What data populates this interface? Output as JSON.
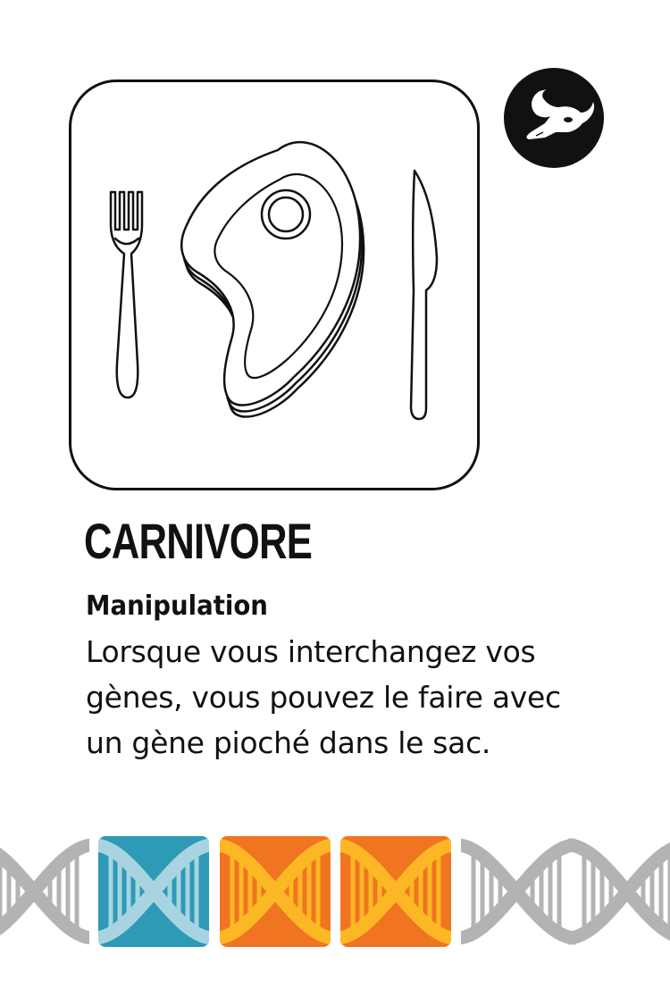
{
  "card": {
    "title": "CARNIVORE",
    "ability_type": "Manipulation",
    "ability_text": "Lorsque vous interchangez vos gènes, vous pouvez le faire avec un gène pioché dans le sac.",
    "illustration": "steak-plate-icon",
    "category_icon": "bull-skull-icon",
    "colors": {
      "ink": "#111111",
      "gene_blue": "#2e9ab6",
      "gene_orange": "#f07421",
      "helix_grey": "#b3b3b3",
      "helix_yellow": "#fbb724",
      "helix_light_blue": "#a8d4e2"
    }
  },
  "genes": {
    "slots": [
      {
        "color": "blue"
      },
      {
        "color": "orange"
      },
      {
        "color": "orange"
      }
    ]
  }
}
